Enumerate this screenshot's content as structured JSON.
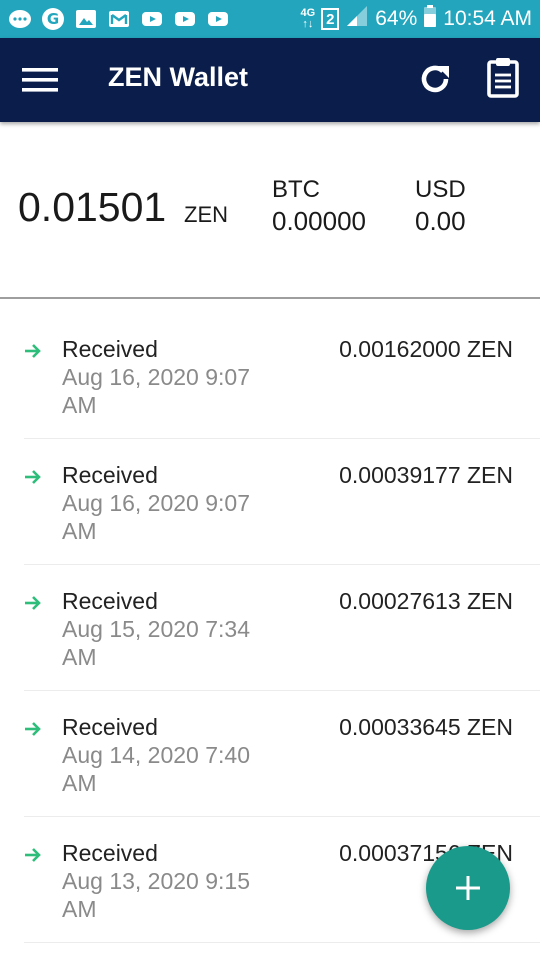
{
  "status_bar": {
    "network": "4G",
    "sim": "2",
    "battery": "64%",
    "time": "10:54 AM",
    "icons": [
      "chat-icon",
      "google-icon",
      "gallery-icon",
      "gmail-icon",
      "youtube-icon",
      "youtube-icon",
      "youtube-icon"
    ]
  },
  "app_bar": {
    "title": "ZEN Wallet",
    "icons": [
      "menu-icon",
      "refresh-icon",
      "clipboard-icon"
    ]
  },
  "balance": {
    "amount": "0.01501",
    "unit": "ZEN",
    "btc_label": "BTC",
    "btc_value": "0.00000",
    "usd_label": "USD",
    "usd_value": "0.00"
  },
  "transactions": [
    {
      "label": "Received",
      "date": "Aug 16, 2020 9:07 AM",
      "amount": "0.00162000 ZEN"
    },
    {
      "label": "Received",
      "date": "Aug 16, 2020 9:07 AM",
      "amount": "0.00039177 ZEN"
    },
    {
      "label": "Received",
      "date": "Aug 15, 2020 7:34 AM",
      "amount": "0.00027613 ZEN"
    },
    {
      "label": "Received",
      "date": "Aug 14, 2020 7:40 AM",
      "amount": "0.00033645 ZEN"
    },
    {
      "label": "Received",
      "date": "Aug 13, 2020 9:15 AM",
      "amount": "0.00037156 ZEN"
    }
  ],
  "colors": {
    "status_bar": "#23a6bd",
    "app_bar": "#0b1e4b",
    "received_arrow": "#2ebd7a",
    "fab": "#1a9a8a"
  },
  "fab_icon": "plus-icon"
}
